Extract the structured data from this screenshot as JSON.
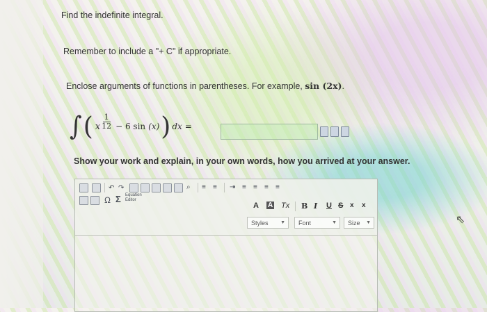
{
  "question": {
    "prompt": "Find the indefinite integral.",
    "remember": "Remember to include a \"+ C\" if appropriate.",
    "enclose_prefix": "Enclose arguments of functions in parentheses. For example, ",
    "enclose_example": "sin (2x)",
    "enclose_suffix": "."
  },
  "integral": {
    "sign": "∫",
    "open_paren": "(",
    "base": "x",
    "exp_num": "1",
    "exp_den": "12",
    "minus_term": "− 6 sin",
    "arg": "(x)",
    "close_paren": ")",
    "dx": "dx",
    "equals": "="
  },
  "answer": {
    "value": ""
  },
  "instructions": "Show your work and explain, in your own words, how you arrived at your answer.",
  "editor": {
    "toolbar": {
      "equation_line1": "Equation",
      "equation_line2": "Editor",
      "omega": "Ω",
      "sigma": "Σ",
      "font_color": "A",
      "bg_color": "A",
      "remove_format": "Tx",
      "bold": "B",
      "italic": "I",
      "underline": "U",
      "strike": "S",
      "subscript": "x",
      "superscript": "x",
      "styles": "Styles",
      "font": "Font",
      "size": "Size"
    },
    "body_text": ""
  },
  "colors": {
    "accent": "#8fbf8f",
    "border": "#b7bcb5"
  }
}
